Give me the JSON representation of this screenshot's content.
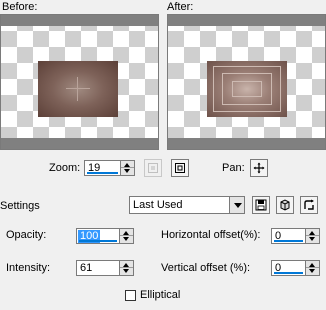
{
  "preview": {
    "before_label": "Before:",
    "after_label": "After:"
  },
  "zoom": {
    "label": "Zoom:",
    "value": "19"
  },
  "pan": {
    "label": "Pan:"
  },
  "settings": {
    "label": "Settings",
    "preset_value": "Last Used"
  },
  "params": {
    "opacity_label": "Opacity:",
    "opacity_value": "100",
    "intensity_label": "Intensity:",
    "intensity_value": "61",
    "hoffset_label": "Horizontal offset(%):",
    "hoffset_value": "0",
    "voffset_label": "Vertical offset (%):",
    "voffset_value": "0",
    "elliptical_label": "Elliptical",
    "elliptical_checked": false
  },
  "icons": {
    "zoom_fit": "zoom-fit-icon",
    "zoom_actual": "zoom-actual-size-icon",
    "pan": "pan-move-icon",
    "save_preset": "save-preset-icon",
    "reset_preset": "reset-preset-icon",
    "randomize": "randomize-icon"
  },
  "colors": {
    "selection_highlight": "#3399ff",
    "focus_underline": "#0078d7",
    "preview_band": "#808080"
  }
}
